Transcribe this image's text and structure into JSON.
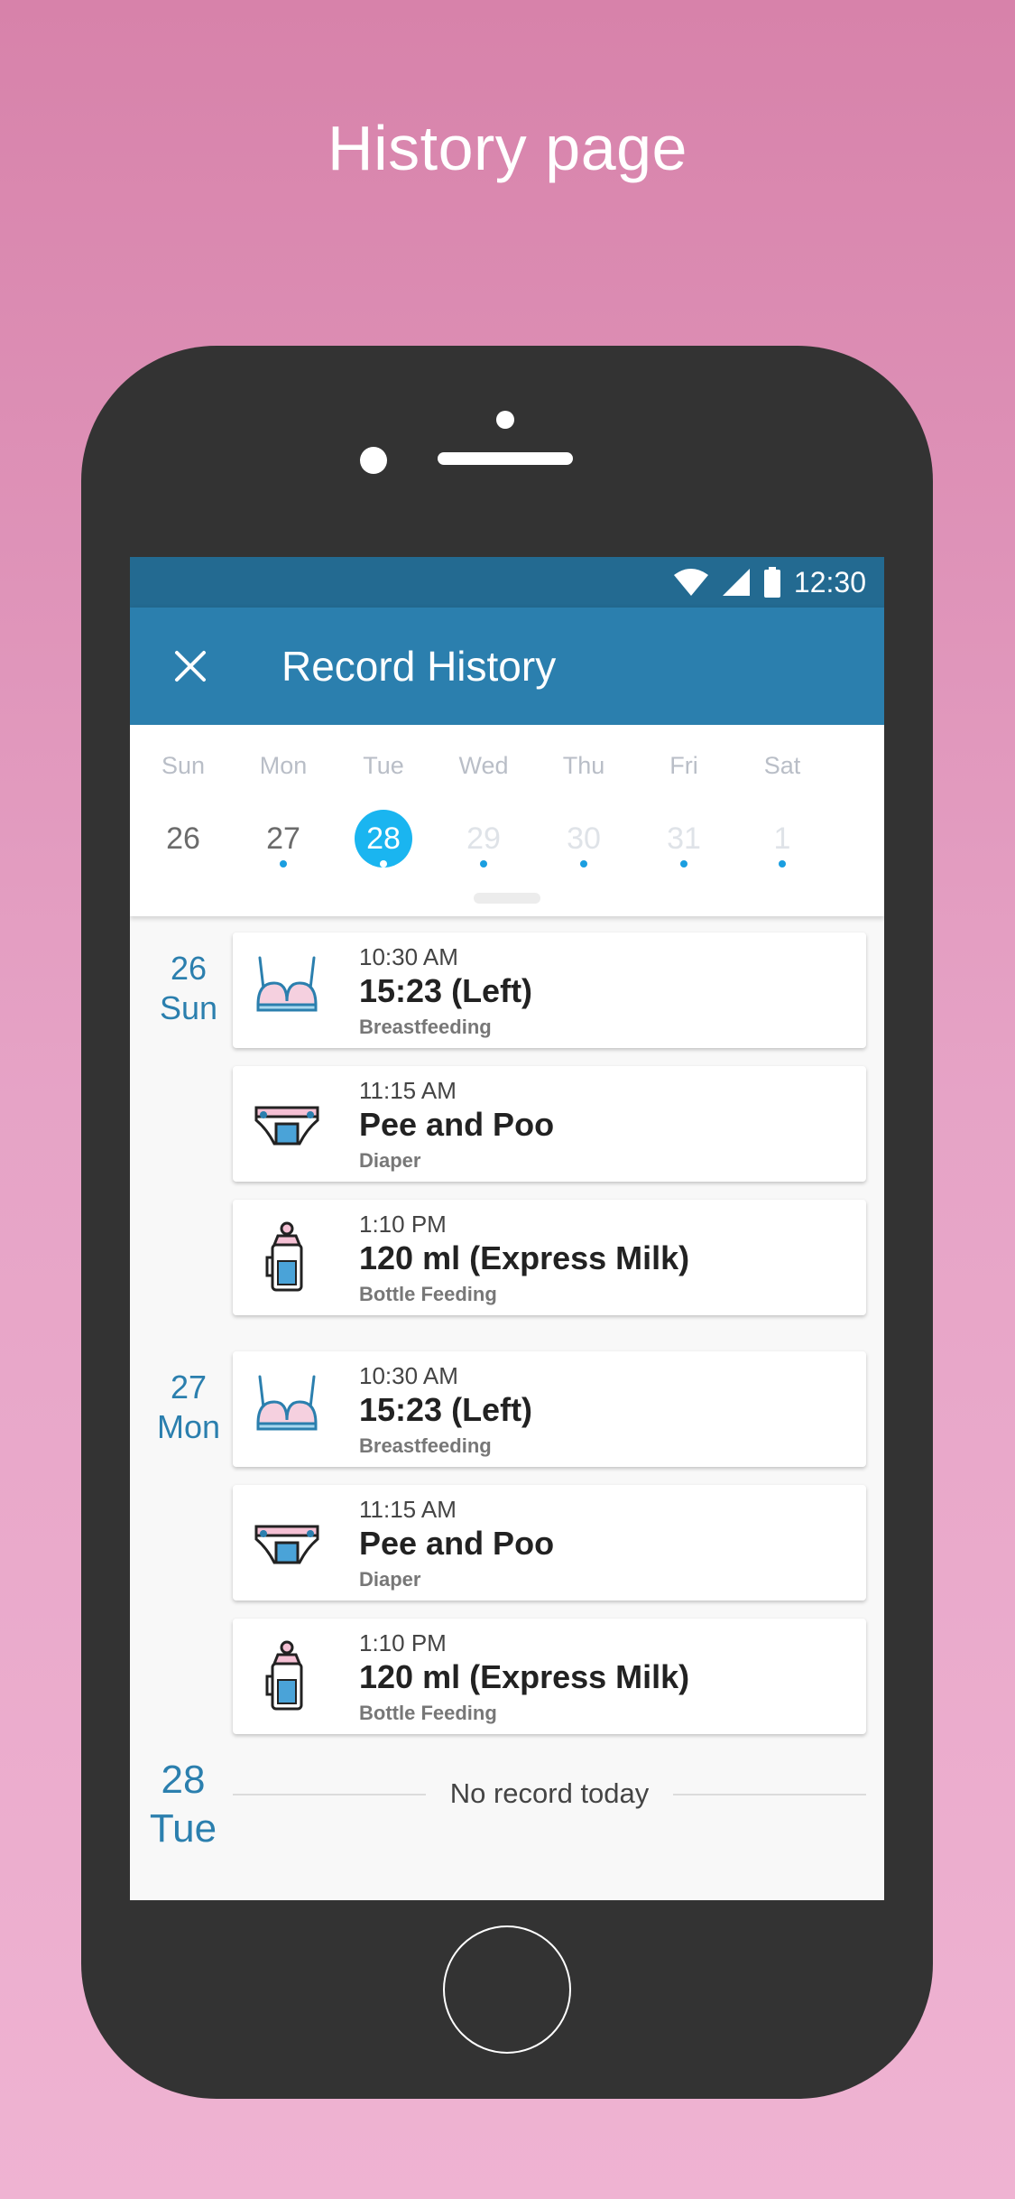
{
  "headline": "History page",
  "status_bar": {
    "time": "12:30",
    "icons": [
      "wifi-icon",
      "signal-icon",
      "battery-icon"
    ]
  },
  "app_bar": {
    "title": "Record History",
    "close_icon": "close-icon"
  },
  "week": {
    "days": [
      {
        "name": "Sun",
        "num": "26",
        "state": "past",
        "has_record": false
      },
      {
        "name": "Mon",
        "num": "27",
        "state": "past",
        "has_record": true
      },
      {
        "name": "Tue",
        "num": "28",
        "state": "selected",
        "has_record": true
      },
      {
        "name": "Wed",
        "num": "29",
        "state": "future",
        "has_record": true
      },
      {
        "name": "Thu",
        "num": "30",
        "state": "future",
        "has_record": true
      },
      {
        "name": "Fri",
        "num": "31",
        "state": "future",
        "has_record": true
      },
      {
        "name": "Sat",
        "num": "1",
        "state": "future",
        "has_record": true
      }
    ]
  },
  "history": {
    "day26": {
      "date": "26",
      "weekday": "Sun",
      "records": [
        {
          "time": "10:30 AM",
          "value": "15:23 (Left)",
          "type": "Breastfeeding",
          "icon": "breastfeeding-icon"
        },
        {
          "time": "11:15 AM",
          "value": "Pee and Poo",
          "type": "Diaper",
          "icon": "diaper-icon"
        },
        {
          "time": "1:10 PM",
          "value": "120 ml (Express Milk)",
          "type": "Bottle Feeding",
          "icon": "bottle-icon"
        }
      ]
    },
    "day27": {
      "date": "27",
      "weekday": "Mon",
      "records": [
        {
          "time": "10:30 AM",
          "value": "15:23 (Left)",
          "type": "Breastfeeding",
          "icon": "breastfeeding-icon"
        },
        {
          "time": "11:15 AM",
          "value": "Pee and Poo",
          "type": "Diaper",
          "icon": "diaper-icon"
        },
        {
          "time": "1:10 PM",
          "value": "120 ml (Express Milk)",
          "type": "Bottle Feeding",
          "icon": "bottle-icon"
        }
      ]
    },
    "day28": {
      "date": "28",
      "weekday": "Tue",
      "empty_text": "No record today"
    }
  },
  "colors": {
    "primary": "#2b7fae",
    "status_bar": "#236a91",
    "accent": "#1ab5f0",
    "background": "#d782aa"
  }
}
